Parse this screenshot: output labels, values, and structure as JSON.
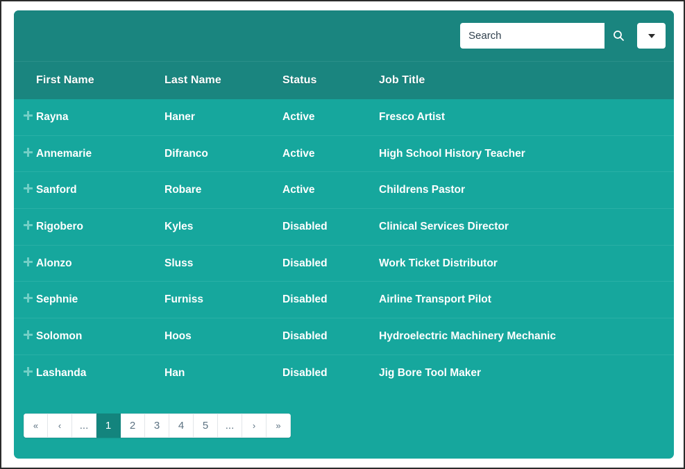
{
  "search": {
    "placeholder": "Search",
    "value": "",
    "search_icon": "search-icon",
    "dropdown_icon": "chevron-down-icon"
  },
  "table": {
    "columns": [
      {
        "key": "first_name",
        "label": "First Name"
      },
      {
        "key": "last_name",
        "label": "Last Name"
      },
      {
        "key": "status",
        "label": "Status"
      },
      {
        "key": "job_title",
        "label": "Job Title"
      }
    ],
    "expand_icon": "plus-icon",
    "rows": [
      {
        "first_name": "Rayna",
        "last_name": "Haner",
        "status": "Active",
        "job_title": "Fresco Artist"
      },
      {
        "first_name": "Annemarie",
        "last_name": "Difranco",
        "status": "Active",
        "job_title": "High School History Teacher"
      },
      {
        "first_name": "Sanford",
        "last_name": "Robare",
        "status": "Active",
        "job_title": "Childrens Pastor"
      },
      {
        "first_name": "Rigobero",
        "last_name": "Kyles",
        "status": "Disabled",
        "job_title": "Clinical Services Director"
      },
      {
        "first_name": "Alonzo",
        "last_name": "Sluss",
        "status": "Disabled",
        "job_title": "Work Ticket Distributor"
      },
      {
        "first_name": "Sephnie",
        "last_name": "Furniss",
        "status": "Disabled",
        "job_title": "Airline Transport Pilot"
      },
      {
        "first_name": "Solomon",
        "last_name": "Hoos",
        "status": "Disabled",
        "job_title": "Hydroelectric Machinery Mechanic"
      },
      {
        "first_name": "Lashanda",
        "last_name": "Han",
        "status": "Disabled",
        "job_title": "Jig Bore Tool Maker"
      }
    ]
  },
  "pagination": {
    "current_page": "1",
    "buttons": [
      {
        "label": "«",
        "name": "pagination-first",
        "active": false,
        "chevron": true
      },
      {
        "label": "‹",
        "name": "pagination-previous",
        "active": false,
        "chevron": true
      },
      {
        "label": "...",
        "name": "pagination-ellipsis-start",
        "active": false,
        "chevron": false
      },
      {
        "label": "1",
        "name": "pagination-page-1",
        "active": true,
        "chevron": false
      },
      {
        "label": "2",
        "name": "pagination-page-2",
        "active": false,
        "chevron": false
      },
      {
        "label": "3",
        "name": "pagination-page-3",
        "active": false,
        "chevron": false
      },
      {
        "label": "4",
        "name": "pagination-page-4",
        "active": false,
        "chevron": false
      },
      {
        "label": "5",
        "name": "pagination-page-5",
        "active": false,
        "chevron": false
      },
      {
        "label": "...",
        "name": "pagination-ellipsis-end",
        "active": false,
        "chevron": false
      },
      {
        "label": "›",
        "name": "pagination-next",
        "active": false,
        "chevron": true
      },
      {
        "label": "»",
        "name": "pagination-last",
        "active": false,
        "chevron": true
      }
    ]
  },
  "colors": {
    "panel_teal": "#16a79d",
    "header_teal": "#1a857f",
    "active_page_teal": "#13847d",
    "row_divider": "#29b0a6",
    "plus_icon": "#72cfc6",
    "frame": "#2b2b2b"
  }
}
